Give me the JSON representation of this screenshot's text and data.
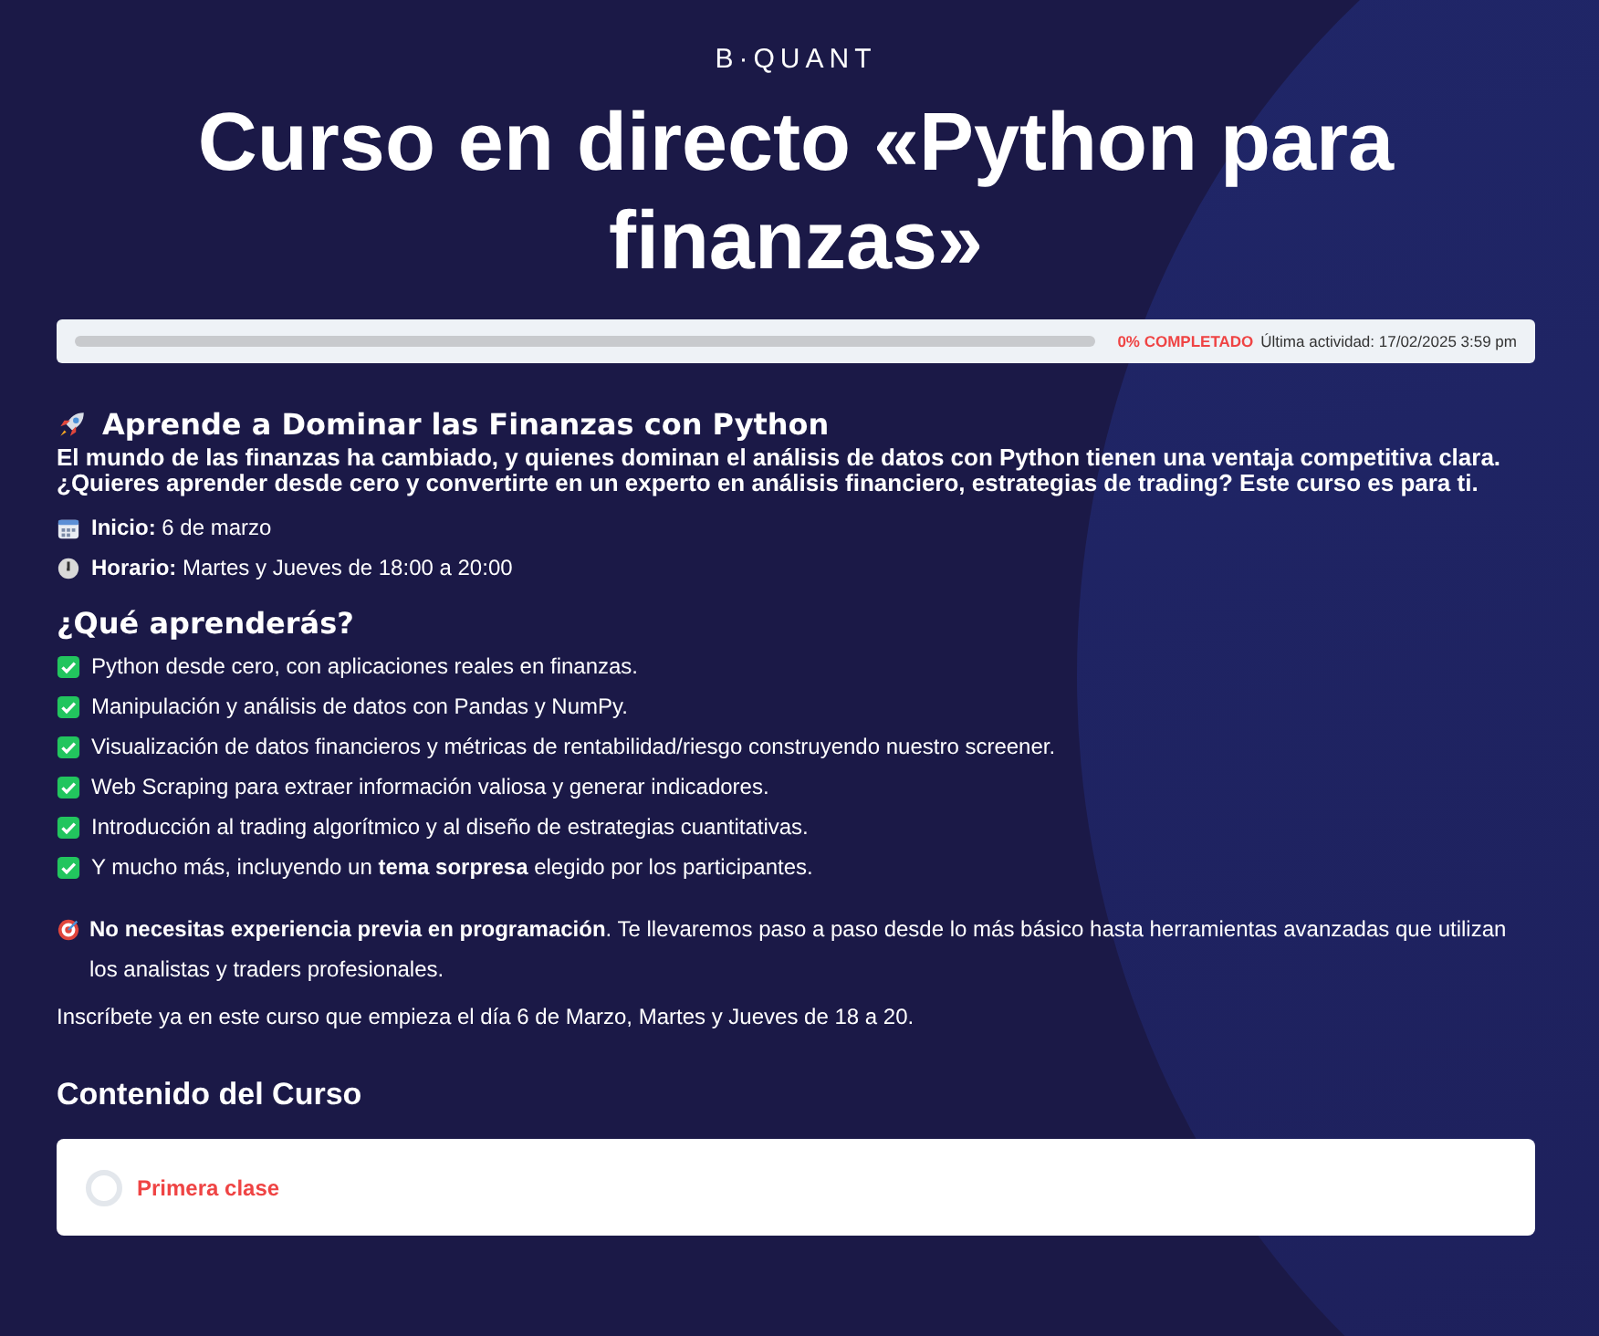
{
  "brand": "B·QUANT",
  "title": "Curso en directo «Python para finanzas»",
  "progress": {
    "level": 0,
    "percent": "0% COMPLETADO",
    "last_activity": "Última actividad: 17/02/2025 3:59 pm"
  },
  "intro": {
    "heading": "Aprende a Dominar las Finanzas con Python",
    "text": "El mundo de las finanzas ha cambiado, y quienes dominan el análisis de datos con Python tienen una ventaja competitiva clara. ¿Quieres aprender desde cero y convertirte en un experto en análisis financiero, estrategias de trading? **Este curso es para ti.**"
  },
  "details": [
    {
      "kind": "calendar",
      "text": "**Inicio:** 6 de marzo"
    },
    {
      "kind": "clock",
      "text": "**Horario:** Martes y Jueves de 18:00 a 20:00"
    }
  ],
  "learn": {
    "heading": "¿Qué aprenderás?",
    "items": [
      "Python desde cero, con aplicaciones reales en finanzas.",
      "Manipulación y análisis de datos con Pandas y NumPy.",
      "Visualización de datos financieros y métricas de rentabilidad/riesgo construyendo nuestro screener.",
      "Web Scraping para extraer información valiosa y generar indicadores.",
      "Introducción al trading algorítmico y al diseño de estrategias cuantitativas.",
      "Y mucho más, incluyendo un **tema sorpresa** elegido por los participantes."
    ]
  },
  "note": "**No necesitas experiencia previa en programación**. Te llevaremos paso a paso desde lo más básico hasta herramientas avanzadas que utilizan los analistas y traders profesionales.",
  "enroll": "Inscríbete ya en este curso que empieza el día 6 de Marzo, Martes y Jueves de 18 a 20.",
  "content": {
    "heading": "Contenido del Curso",
    "lessons": [
      {
        "title": "Primera clase",
        "completed": false
      }
    ]
  }
}
